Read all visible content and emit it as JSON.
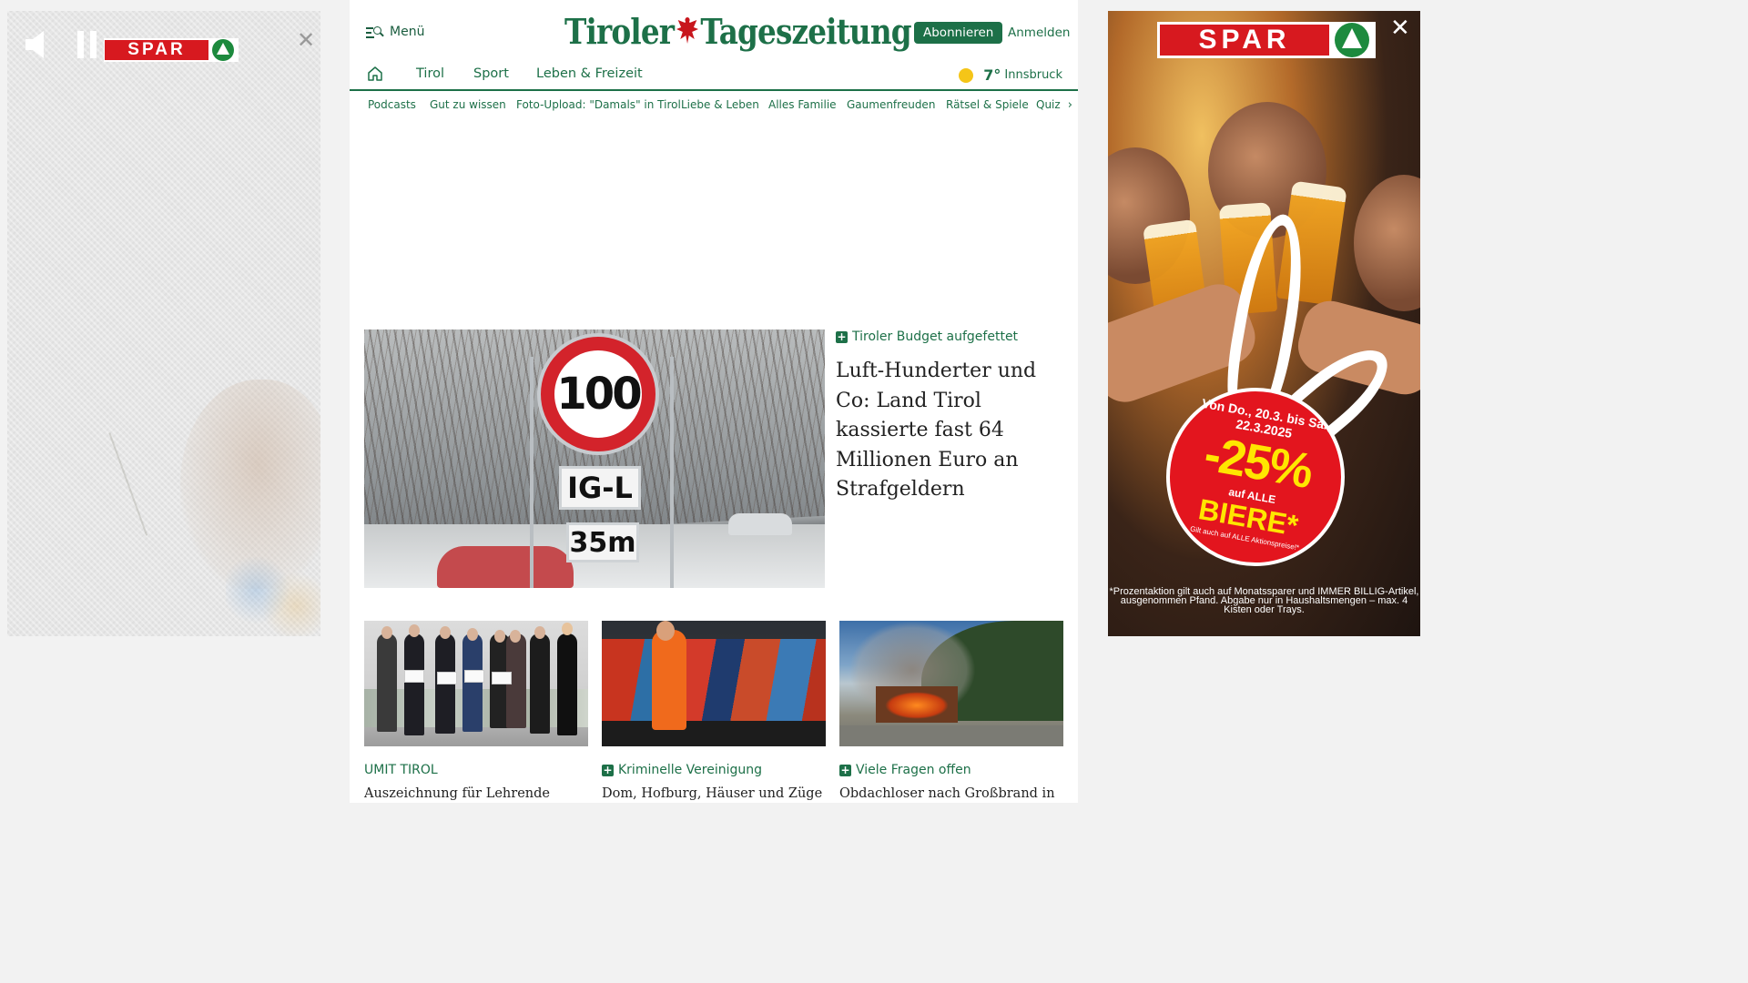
{
  "ads": {
    "left": {
      "brand": "SPAR"
    },
    "right": {
      "brand": "SPAR",
      "badge_date": "Von Do., 20.3. bis Sa., 22.3.2025",
      "badge_percent": "-25%",
      "badge_auf": "auf ALLE",
      "badge_biere": "BIERE*",
      "badge_fine": "Gilt auch auf ALLE Aktionspreise!*",
      "disclaimer": "*Prozentaktion gilt auch auf Monatssparer und IMMER BILLIG-Artikel, ausgenommen Pfand. Abgabe nur in Haushaltsmengen – max. 4 Kisten oder Trays."
    }
  },
  "header": {
    "menu_label": "Menü",
    "logo_left": "Tiroler",
    "logo_right": "Tageszeitung",
    "subscribe_label": "Abonnieren",
    "login_label": "Anmelden"
  },
  "nav_primary": [
    {
      "label": "Tirol"
    },
    {
      "label": "Sport"
    },
    {
      "label": "Leben & Freizeit"
    }
  ],
  "weather": {
    "temp": "7°",
    "city": "Innsbruck"
  },
  "nav_secondary": [
    {
      "label": "Podcasts"
    },
    {
      "label": "Gut zu wissen"
    },
    {
      "label": "Foto-Upload: \"Damals\" in Tirol"
    },
    {
      "label": "Liebe & Leben"
    },
    {
      "label": "Alles Familie"
    },
    {
      "label": "Gaumenfreuden"
    },
    {
      "label": "Rätsel & Spiele"
    },
    {
      "label": "Quiz"
    }
  ],
  "lead_article": {
    "kicker": "Tiroler Budget aufgefettet",
    "title": "Luft-Hunderter und Co: Land Tirol kassierte fast 64 Millionen Euro an Strafgeldern",
    "image": {
      "sign_speed": "100",
      "sign_plate1": "IG-L",
      "sign_plate2": "35m"
    }
  },
  "cards": [
    {
      "kicker": "UMIT TIROL",
      "premium": false,
      "title": "Auszeichnung für Lehrende"
    },
    {
      "kicker": "Kriminelle Vereinigung",
      "premium": true,
      "title": "Dom, Hofburg, Häuser und Züge"
    },
    {
      "kicker": "Viele Fragen offen",
      "premium": true,
      "title": "Obdachloser nach Großbrand in"
    }
  ],
  "colors": {
    "brand_green": "#1d7048",
    "spar_red": "#d7191f"
  }
}
